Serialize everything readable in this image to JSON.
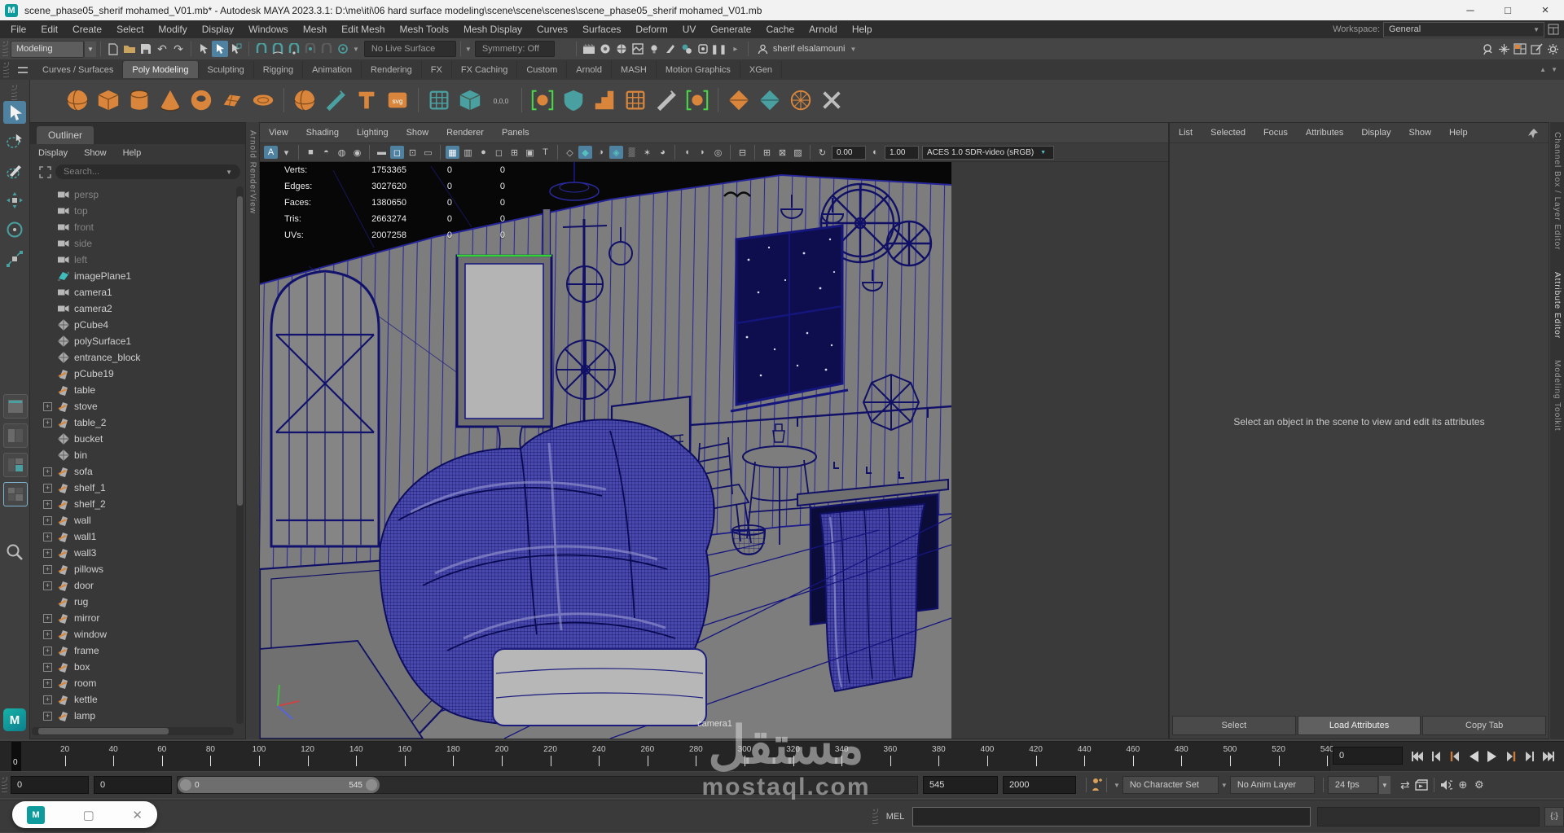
{
  "title_bar": {
    "title": "scene_phase05_sherif mohamed_V01.mb* - Autodesk MAYA 2023.3.1: D:\\me\\iti\\06 hard surface modeling\\scene\\scene\\scenes\\scene_phase05_sherif mohamed_V01.mb",
    "minimize": "─",
    "maximize": "□",
    "close": "×"
  },
  "menu_bar": {
    "items": [
      "File",
      "Edit",
      "Create",
      "Select",
      "Modify",
      "Display",
      "Windows",
      "Mesh",
      "Edit Mesh",
      "Mesh Tools",
      "Mesh Display",
      "Curves",
      "Surfaces",
      "Deform",
      "UV",
      "Generate",
      "Cache",
      "Arnold",
      "Help"
    ],
    "workspace_label": "Workspace:",
    "workspace_value": "General"
  },
  "status_line": {
    "mode": "Modeling",
    "no_live_surface": "No Live Surface",
    "symmetry": "Symmetry: Off",
    "account": "sherif elsalamouni"
  },
  "shelf": {
    "tabs": [
      "Curves / Surfaces",
      "Poly Modeling",
      "Sculpting",
      "Rigging",
      "Animation",
      "Rendering",
      "FX",
      "FX Caching",
      "Custom",
      "Arnold",
      "MASH",
      "Motion Graphics",
      "XGen"
    ],
    "active_tab": "Poly Modeling",
    "icons": [
      {
        "s": "ball",
        "c": "#d9863c",
        "n": "poly-sphere-icon"
      },
      {
        "s": "cube",
        "c": "#d9863c",
        "n": "poly-cube-icon"
      },
      {
        "s": "cyl",
        "c": "#d9863c",
        "n": "poly-cylinder-icon"
      },
      {
        "s": "cone",
        "c": "#d9863c",
        "n": "poly-cone-icon"
      },
      {
        "s": "torus",
        "c": "#d9863c",
        "n": "poly-torus-icon"
      },
      {
        "s": "plane",
        "c": "#d9863c",
        "n": "poly-plane-icon"
      },
      {
        "s": "disc",
        "c": "#d9863c",
        "n": "poly-disc-icon"
      },
      {
        "s": "sep"
      },
      {
        "s": "ball",
        "c": "#d9863c",
        "n": "platonic-solid-icon"
      },
      {
        "s": "knife",
        "c": "#4aa0a0",
        "n": "curve-tool-icon"
      },
      {
        "s": "T",
        "c": "#d9863c",
        "n": "poly-type-icon"
      },
      {
        "s": "svg",
        "c": "#d9863c",
        "n": "svg-tool-icon"
      },
      {
        "s": "sep"
      },
      {
        "s": "grid",
        "c": "#4aa0a0",
        "n": "modeling-toolkit-icon"
      },
      {
        "s": "cube",
        "c": "#4aa0a0",
        "n": "sweep-mesh-icon"
      },
      {
        "s": "zero",
        "c": "#bdbdbd",
        "n": "reset-transform-icon"
      },
      {
        "s": "sep"
      },
      {
        "s": "brack",
        "c": "#d9863c",
        "n": "isolate-select-icon"
      },
      {
        "s": "shield",
        "c": "#4aa0a0",
        "n": "cleanup-icon"
      },
      {
        "s": "steps",
        "c": "#d9863c",
        "n": "smooth-steps-icon"
      },
      {
        "s": "grid",
        "c": "#d9863c",
        "n": "quad-draw-icon"
      },
      {
        "s": "knife",
        "c": "#bdbdbd",
        "n": "multi-cut-icon"
      },
      {
        "s": "brack",
        "c": "#d9863c",
        "n": "isolate-add-icon"
      },
      {
        "s": "sep"
      },
      {
        "s": "diam",
        "c": "#d9863c",
        "n": "combine-icon"
      },
      {
        "s": "diam",
        "c": "#4aa0a0",
        "n": "separate-icon"
      },
      {
        "s": "web",
        "c": "#d9863c",
        "n": "wireframe-sphere-icon"
      },
      {
        "s": "x",
        "c": "#bdbdbd",
        "n": "delete-history-icon"
      }
    ]
  },
  "outliner": {
    "tab": "Outliner",
    "menus": [
      "Display",
      "Show",
      "Help"
    ],
    "search_placeholder": "Search...",
    "items": [
      {
        "label": "persp",
        "icon": "camera",
        "muted": true
      },
      {
        "label": "top",
        "icon": "camera",
        "muted": true
      },
      {
        "label": "front",
        "icon": "camera",
        "muted": true
      },
      {
        "label": "side",
        "icon": "camera",
        "muted": true
      },
      {
        "label": "left",
        "icon": "camera",
        "muted": true
      },
      {
        "label": "imagePlane1",
        "icon": "imageplane"
      },
      {
        "label": "camera1",
        "icon": "camera"
      },
      {
        "label": "camera2",
        "icon": "camera"
      },
      {
        "label": "pCube4",
        "icon": "mesh"
      },
      {
        "label": "polySurface1",
        "icon": "mesh"
      },
      {
        "label": "entrance_block",
        "icon": "mesh"
      },
      {
        "label": "pCube19",
        "icon": "transform"
      },
      {
        "label": "table",
        "icon": "transform"
      },
      {
        "label": "stove",
        "icon": "transform",
        "expandable": true
      },
      {
        "label": "table_2",
        "icon": "transform",
        "expandable": true
      },
      {
        "label": "bucket",
        "icon": "mesh"
      },
      {
        "label": "bin",
        "icon": "mesh"
      },
      {
        "label": "sofa",
        "icon": "transform",
        "expandable": true
      },
      {
        "label": "shelf_1",
        "icon": "transform",
        "expandable": true
      },
      {
        "label": "shelf_2",
        "icon": "transform",
        "expandable": true
      },
      {
        "label": "wall",
        "icon": "transform",
        "expandable": true
      },
      {
        "label": "wall1",
        "icon": "transform",
        "expandable": true
      },
      {
        "label": "wall3",
        "icon": "transform",
        "expandable": true
      },
      {
        "label": "pillows",
        "icon": "transform",
        "expandable": true
      },
      {
        "label": "door",
        "icon": "transform",
        "expandable": true
      },
      {
        "label": "rug",
        "icon": "transform"
      },
      {
        "label": "mirror",
        "icon": "transform",
        "expandable": true
      },
      {
        "label": "window",
        "icon": "transform",
        "expandable": true
      },
      {
        "label": "frame",
        "icon": "transform",
        "expandable": true
      },
      {
        "label": "box",
        "icon": "transform",
        "expandable": true
      },
      {
        "label": "room",
        "icon": "transform",
        "expandable": true
      },
      {
        "label": "kettle",
        "icon": "transform",
        "expandable": true
      },
      {
        "label": "lamp",
        "icon": "transform",
        "expandable": true
      }
    ]
  },
  "viewport": {
    "arnold_tab": "Arnold RenderView",
    "menus": [
      "View",
      "Shading",
      "Lighting",
      "Show",
      "Renderer",
      "Panels"
    ],
    "toolbar": [
      {
        "t": "i",
        "g": "A",
        "lit": 1,
        "n": "camera-attributes-icon"
      },
      {
        "t": "i",
        "g": "▾",
        "n": "dropdown-icon"
      },
      {
        "t": "sep"
      },
      {
        "t": "i",
        "g": "■",
        "n": "wireframe-mode-icon"
      },
      {
        "t": "i",
        "g": "◓",
        "n": "shaded-mode-icon"
      },
      {
        "t": "i",
        "g": "◍",
        "n": "textured-mode-icon"
      },
      {
        "t": "i",
        "g": "◉",
        "n": "lit-mode-icon"
      },
      {
        "t": "sep"
      },
      {
        "t": "i",
        "g": "▬",
        "n": "camera-icon"
      },
      {
        "t": "i",
        "g": "◻",
        "lit": 1,
        "n": "camera-lock-icon"
      },
      {
        "t": "i",
        "g": "⊡",
        "n": "film-gate-icon"
      },
      {
        "t": "i",
        "g": "▭",
        "n": "resolution-gate-icon"
      },
      {
        "t": "sep"
      },
      {
        "t": "i",
        "g": "▦",
        "lit": 1,
        "n": "gate-mask-icon"
      },
      {
        "t": "i",
        "g": "▥",
        "n": "field-chart-icon"
      },
      {
        "t": "i",
        "g": "●",
        "n": "safe-action-icon"
      },
      {
        "t": "i",
        "g": "◻",
        "n": "safe-title-icon"
      },
      {
        "t": "i",
        "g": "⊞",
        "n": "frame-all-icon"
      },
      {
        "t": "i",
        "g": "▣",
        "n": "image-plane-icon"
      },
      {
        "t": "i",
        "g": "T",
        "n": "hud-toggle-icon"
      },
      {
        "t": "sep"
      },
      {
        "t": "i",
        "g": "◇",
        "n": "xray-icon"
      },
      {
        "t": "i",
        "g": "◆",
        "lit": 1,
        "teal": 1,
        "n": "xray-joints-icon"
      },
      {
        "t": "i",
        "g": "◑",
        "n": "xray-active-icon"
      },
      {
        "t": "i",
        "g": "◈",
        "lit": 1,
        "teal": 1,
        "n": "wireframe-on-shaded-icon"
      },
      {
        "t": "i",
        "g": "▒",
        "n": "default-material-icon"
      },
      {
        "t": "i",
        "g": "✶",
        "n": "lights-icon"
      },
      {
        "t": "i",
        "g": "◕",
        "n": "shadows-icon"
      },
      {
        "t": "sep"
      },
      {
        "t": "i",
        "g": "◖",
        "n": "ao-icon"
      },
      {
        "t": "i",
        "g": "◗",
        "n": "motion-blur-icon"
      },
      {
        "t": "i",
        "g": "◎",
        "n": "dof-icon"
      },
      {
        "t": "sep"
      },
      {
        "t": "i",
        "g": "⊟",
        "n": "isolate-select-icon"
      },
      {
        "t": "sep"
      },
      {
        "t": "i",
        "g": "⊞",
        "n": "multi-pass-icon"
      },
      {
        "t": "i",
        "g": "⊠",
        "n": "anti-alias-icon"
      },
      {
        "t": "i",
        "g": "▨",
        "n": "viewport-settings-icon"
      },
      {
        "t": "sep"
      },
      {
        "t": "i",
        "g": "↻",
        "n": "exposure-icon"
      },
      {
        "t": "f",
        "v": "0.00",
        "n": "exposure-field"
      },
      {
        "t": "i",
        "g": "◐",
        "n": "gamma-icon"
      },
      {
        "t": "f",
        "v": "1.00",
        "n": "gamma-field"
      },
      {
        "t": "cs"
      }
    ],
    "colorspace": "ACES 1.0 SDR-video (sRGB)",
    "hud": {
      "rows": [
        {
          "label": "Verts:",
          "v1": "1753365",
          "v2": "0",
          "v3": "0"
        },
        {
          "label": "Edges:",
          "v1": "3027620",
          "v2": "0",
          "v3": "0"
        },
        {
          "label": "Faces:",
          "v1": "1380650",
          "v2": "0",
          "v3": "0"
        },
        {
          "label": "Tris:",
          "v1": "2663274",
          "v2": "0",
          "v3": "0"
        },
        {
          "label": "UVs:",
          "v1": "2007258",
          "v2": "0",
          "v3": "0"
        }
      ]
    },
    "camera_label": "camera1"
  },
  "attribute_editor": {
    "menus": [
      "List",
      "Selected",
      "Focus",
      "Attributes",
      "Display",
      "Show",
      "Help"
    ],
    "message": "Select an object in the scene to view and edit its attributes",
    "buttons": [
      "Select",
      "Load Attributes",
      "Copy Tab"
    ],
    "active_button": "Load Attributes",
    "side_tabs": [
      "Channel Box / Layer Editor",
      "Attribute Editor",
      "Modeling Toolkit"
    ]
  },
  "timeline": {
    "ticks": [
      "0",
      "20",
      "40",
      "60",
      "80",
      "100",
      "120",
      "140",
      "160",
      "180",
      "200",
      "220",
      "240",
      "260",
      "280",
      "300",
      "320",
      "340",
      "360",
      "380",
      "400",
      "420",
      "440",
      "460",
      "480",
      "500",
      "520",
      "540"
    ],
    "playhead_label": "0",
    "current_frame": "0",
    "anim_start": "0",
    "playback_start": "0",
    "playback_end": "545",
    "anim_end": "2000",
    "bar_start_label": "0",
    "bar_end_label": "545",
    "character_set": "No Character Set",
    "anim_layer": "No Anim Layer",
    "fps": "24 fps"
  },
  "command_line": {
    "label": "MEL"
  },
  "watermark": {
    "arabic": "مستقل",
    "latin": "mostaql.com"
  },
  "colors": {
    "accent_blue": "#4f81a0",
    "accent_teal": "#4aa0a0",
    "accent_orange": "#d9863c",
    "wire_navy": "#15157e"
  }
}
